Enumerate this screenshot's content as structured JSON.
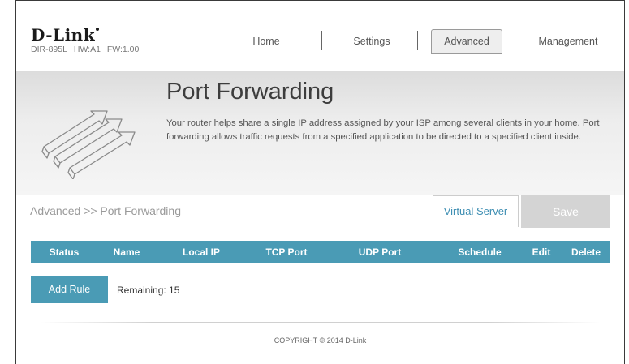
{
  "header": {
    "logo": "D-Link",
    "model": "DIR-895L",
    "hw": "HW:A1",
    "fw": "FW:1.00"
  },
  "nav": {
    "items": [
      {
        "label": "Home",
        "active": false
      },
      {
        "label": "Settings",
        "active": false
      },
      {
        "label": "Advanced",
        "active": true
      },
      {
        "label": "Management",
        "active": false
      }
    ]
  },
  "hero": {
    "title": "Port Forwarding",
    "description": "Your router helps share a single IP address assigned by your ISP among several clients in your home. Port forwarding allows traffic requests from a specified application to be directed to a specified client inside.",
    "icon": "port-forwarding-arrows-icon"
  },
  "breadcrumb": "Advanced >> Port Forwarding",
  "actions": {
    "virtual_server": "Virtual Server",
    "save": "Save"
  },
  "table": {
    "columns": [
      "Status",
      "Name",
      "Local IP",
      "TCP Port",
      "UDP Port",
      "Schedule",
      "Edit",
      "Delete"
    ],
    "rows": []
  },
  "add_rule": {
    "label": "Add Rule",
    "remaining_label": "Remaining: 15"
  },
  "footer": {
    "copyright": "COPYRIGHT © 2014 D-Link"
  },
  "colors": {
    "accent": "#4a9bb5",
    "link": "#3f8fb3",
    "save_disabled": "#d4d4d4"
  }
}
